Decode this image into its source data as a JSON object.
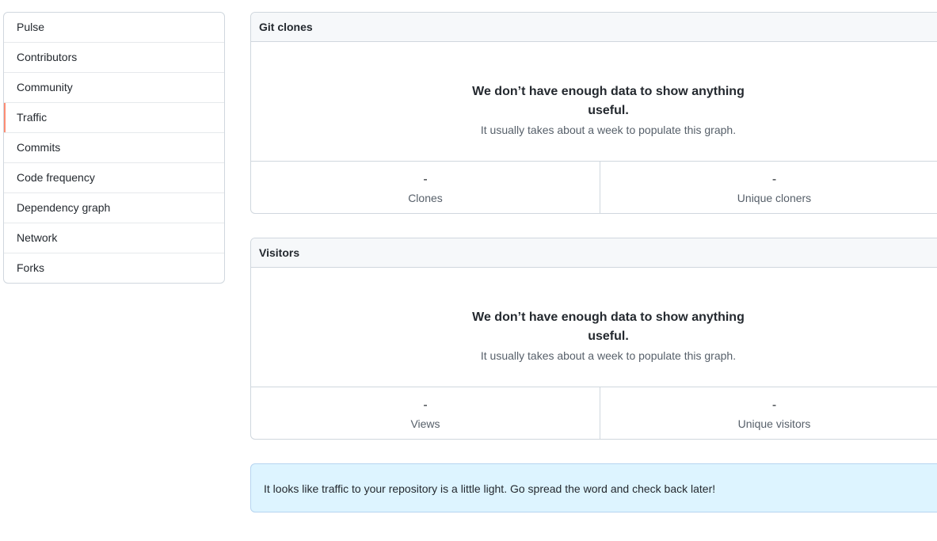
{
  "sidebar": {
    "items": [
      {
        "label": "Pulse"
      },
      {
        "label": "Contributors"
      },
      {
        "label": "Community"
      },
      {
        "label": "Traffic"
      },
      {
        "label": "Commits"
      },
      {
        "label": "Code frequency"
      },
      {
        "label": "Dependency graph"
      },
      {
        "label": "Network"
      },
      {
        "label": "Forks"
      }
    ],
    "selected": "Traffic",
    "selected_accent_color": "#fd8c73"
  },
  "clones": {
    "title": "Git clones",
    "empty_title": "We don’t have enough data to show anything useful.",
    "empty_desc": "It usually takes about a week to populate this graph.",
    "stats": [
      {
        "value": "-",
        "label": "Clones"
      },
      {
        "value": "-",
        "label": "Unique cloners"
      }
    ]
  },
  "visitors": {
    "title": "Visitors",
    "empty_title": "We don’t have enough data to show anything useful.",
    "empty_desc": "It usually takes about a week to populate this graph.",
    "stats": [
      {
        "value": "-",
        "label": "Views"
      },
      {
        "value": "-",
        "label": "Unique visitors"
      }
    ]
  },
  "flash": {
    "message": "It looks like traffic to your repository is a little light. Go spread the word and check back later!",
    "background_color": "#ddf4ff"
  }
}
